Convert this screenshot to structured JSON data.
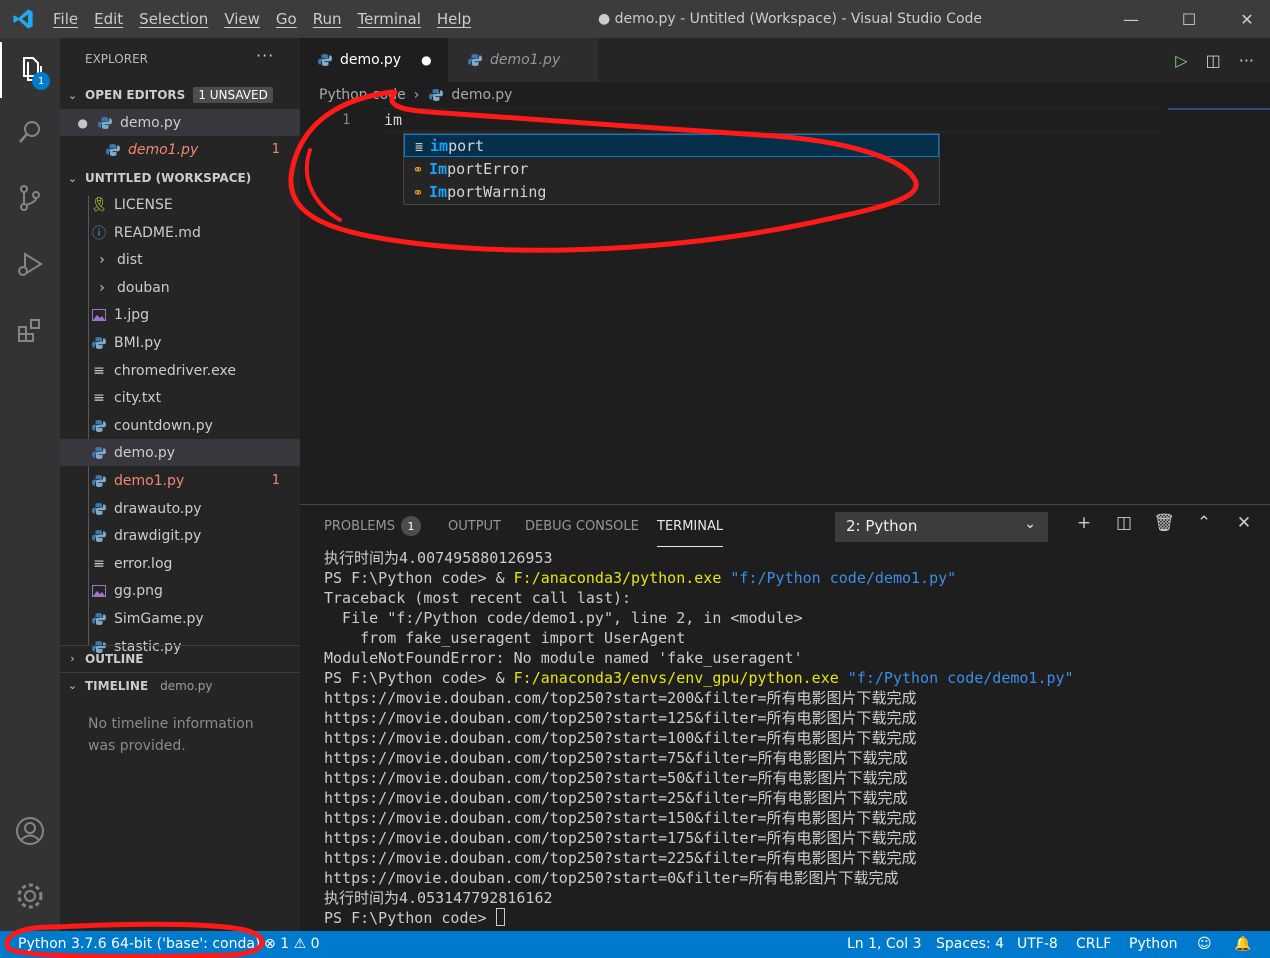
{
  "window": {
    "title": "● demo.py - Untitled (Workspace) - Visual Studio Code",
    "menu": [
      "File",
      "Edit",
      "Selection",
      "View",
      "Go",
      "Run",
      "Terminal",
      "Help"
    ],
    "controls": {
      "minimize": "—",
      "maximize": "☐",
      "close": "✕"
    }
  },
  "activity_bar": {
    "explorer_badge": "1",
    "items": [
      "files-icon",
      "search-icon",
      "source-control-icon",
      "run-debug-icon",
      "extensions-icon",
      "account-icon",
      "gear-icon"
    ]
  },
  "sidebar": {
    "header": "EXPLORER",
    "more": "···",
    "open_editors": {
      "label": "OPEN EDITORS",
      "badge": "1 UNSAVED",
      "items": [
        {
          "name": "demo.py",
          "dirty": true,
          "error": ""
        },
        {
          "name": "demo1.py",
          "dirty": false,
          "error": "1"
        }
      ]
    },
    "workspace": {
      "label": "UNTITLED (WORKSPACE)",
      "items": [
        {
          "name": "LICENSE",
          "icon": "license-icon",
          "error": ""
        },
        {
          "name": "README.md",
          "icon": "info-icon",
          "error": ""
        },
        {
          "name": "dist",
          "icon": "folder-chevron-icon",
          "error": ""
        },
        {
          "name": "douban",
          "icon": "folder-chevron-icon",
          "error": ""
        },
        {
          "name": "1.jpg",
          "icon": "image-icon",
          "error": ""
        },
        {
          "name": "BMI.py",
          "icon": "python-icon",
          "error": ""
        },
        {
          "name": "chromedriver.exe",
          "icon": "file-lines-icon",
          "error": ""
        },
        {
          "name": "city.txt",
          "icon": "file-lines-icon",
          "error": ""
        },
        {
          "name": "countdown.py",
          "icon": "python-icon",
          "error": ""
        },
        {
          "name": "demo.py",
          "icon": "python-icon",
          "error": ""
        },
        {
          "name": "demo1.py",
          "icon": "python-icon",
          "error": "1"
        },
        {
          "name": "drawauto.py",
          "icon": "python-icon",
          "error": ""
        },
        {
          "name": "drawdigit.py",
          "icon": "python-icon",
          "error": ""
        },
        {
          "name": "error.log",
          "icon": "file-lines-icon",
          "error": ""
        },
        {
          "name": "gg.png",
          "icon": "image-icon",
          "error": ""
        },
        {
          "name": "SimGame.py",
          "icon": "python-icon",
          "error": ""
        },
        {
          "name": "stastic.py",
          "icon": "python-icon",
          "error": ""
        }
      ]
    },
    "outline": {
      "label": "OUTLINE"
    },
    "timeline": {
      "label": "TIMELINE",
      "file": "demo.py",
      "message": "No timeline information was provided."
    }
  },
  "editor": {
    "tabs": [
      {
        "label": "demo.py",
        "active": true,
        "dirty_mark": "●"
      },
      {
        "label": "demo1.py",
        "active": false,
        "dirty_mark": ""
      }
    ],
    "breadcrumb": [
      "Python code",
      "demo.py"
    ],
    "line_number": "1",
    "code": "im",
    "suggestions": [
      {
        "label": "import",
        "match": "im",
        "rest": "port",
        "icon": "keyword-icon"
      },
      {
        "label": "ImportError",
        "match": "Im",
        "rest": "portError",
        "icon": "class-icon"
      },
      {
        "label": "ImportWarning",
        "match": "Im",
        "rest": "portWarning",
        "icon": "class-icon"
      }
    ]
  },
  "panel": {
    "tabs": [
      "PROBLEMS",
      "OUTPUT",
      "DEBUG CONSOLE",
      "TERMINAL"
    ],
    "problems_count": "1",
    "terminal_select": "2: Python",
    "terminal_lines": [
      {
        "text": "执行时间为4.007495880126953"
      },
      {
        "prefix": "PS F:\\Python code> & ",
        "exe": "F:/anaconda3/python.exe",
        "arg": " \"f:/Python code/demo1.py\""
      },
      {
        "text": "Traceback (most recent call last):"
      },
      {
        "text": "  File \"f:/Python code/demo1.py\", line 2, in <module>"
      },
      {
        "text": "    from fake_useragent import UserAgent"
      },
      {
        "text": "ModuleNotFoundError: No module named 'fake_useragent'"
      },
      {
        "prefix": "PS F:\\Python code> & ",
        "exe": "F:/anaconda3/envs/env_gpu/python.exe",
        "arg": " \"f:/Python code/demo1.py\""
      },
      {
        "text": "https://movie.douban.com/top250?start=200&filter=所有电影图片下载完成"
      },
      {
        "text": "https://movie.douban.com/top250?start=125&filter=所有电影图片下载完成"
      },
      {
        "text": "https://movie.douban.com/top250?start=100&filter=所有电影图片下载完成"
      },
      {
        "text": "https://movie.douban.com/top250?start=75&filter=所有电影图片下载完成"
      },
      {
        "text": "https://movie.douban.com/top250?start=50&filter=所有电影图片下载完成"
      },
      {
        "text": "https://movie.douban.com/top250?start=25&filter=所有电影图片下载完成"
      },
      {
        "text": "https://movie.douban.com/top250?start=150&filter=所有电影图片下载完成"
      },
      {
        "text": "https://movie.douban.com/top250?start=175&filter=所有电影图片下载完成"
      },
      {
        "text": "https://movie.douban.com/top250?start=225&filter=所有电影图片下载完成"
      },
      {
        "text": "https://movie.douban.com/top250?start=0&filter=所有电影图片下载完成"
      },
      {
        "text": "执行时间为4.053147792816162"
      }
    ],
    "prompt": "PS F:\\Python code> "
  },
  "status_bar": {
    "interpreter": "Python 3.7.6 64-bit ('base': conda)",
    "errors": "1",
    "warnings": "0",
    "position": "Ln 1, Col 3",
    "spaces": "Spaces: 4",
    "encoding": "UTF-8",
    "eol": "CRLF",
    "language": "Python"
  },
  "colors": {
    "accent": "#007acc",
    "annotation": "#ff1a1a",
    "error": "#f48771"
  }
}
